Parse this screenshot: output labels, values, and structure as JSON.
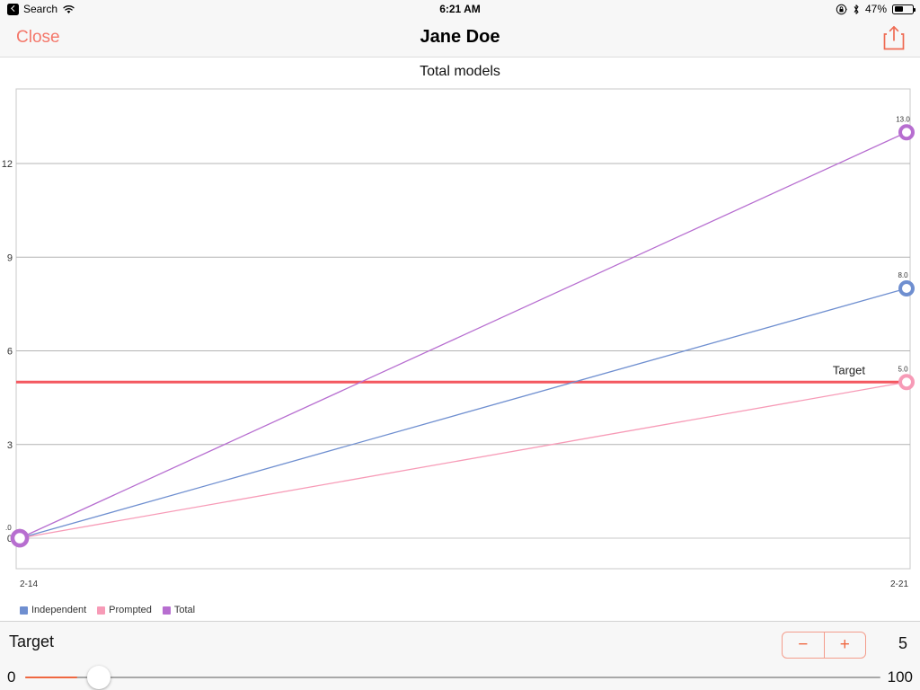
{
  "status_bar": {
    "back_icon": "back-chevron-icon",
    "back_label": "Search",
    "wifi_icon": "wifi-icon",
    "time": "6:21 AM",
    "rotation_lock_icon": "rotation-lock-icon",
    "bluetooth_icon": "bluetooth-icon",
    "battery_percent": "47%",
    "battery_icon": "battery-icon"
  },
  "navbar": {
    "close_label": "Close",
    "title": "Jane Doe",
    "share_icon": "share-icon"
  },
  "chart_data": {
    "type": "line",
    "title": "Total models",
    "xlabel": "",
    "ylabel": "",
    "x": [
      "2-14",
      "2-21"
    ],
    "categories": [
      "2-14",
      "2-21"
    ],
    "ylim": [
      0,
      13.6
    ],
    "yticks": [
      0,
      3,
      6,
      9,
      12
    ],
    "ytick_labels": [
      "0",
      "3",
      "6",
      "9",
      "12"
    ],
    "grid": true,
    "legend_position": "bottom-left",
    "series": [
      {
        "name": "Independent",
        "color": "#6f8fd0",
        "values": [
          0,
          8
        ],
        "point_labels": [
          "",
          "8.0"
        ]
      },
      {
        "name": "Prompted",
        "color": "#f79bb7",
        "values": [
          0,
          5
        ],
        "point_labels": [
          "",
          "5.0"
        ]
      },
      {
        "name": "Total",
        "color": "#b76ed0",
        "values": [
          0,
          13
        ],
        "point_labels": [
          ".0",
          "13.0"
        ]
      }
    ],
    "reference_line": {
      "label": "Target",
      "value": 5,
      "color": "#f4575f"
    }
  },
  "bottom": {
    "target_label": "Target",
    "minus_label": "−",
    "plus_label": "+",
    "target_value": "5",
    "slider_min": "0",
    "slider_max": "100"
  }
}
